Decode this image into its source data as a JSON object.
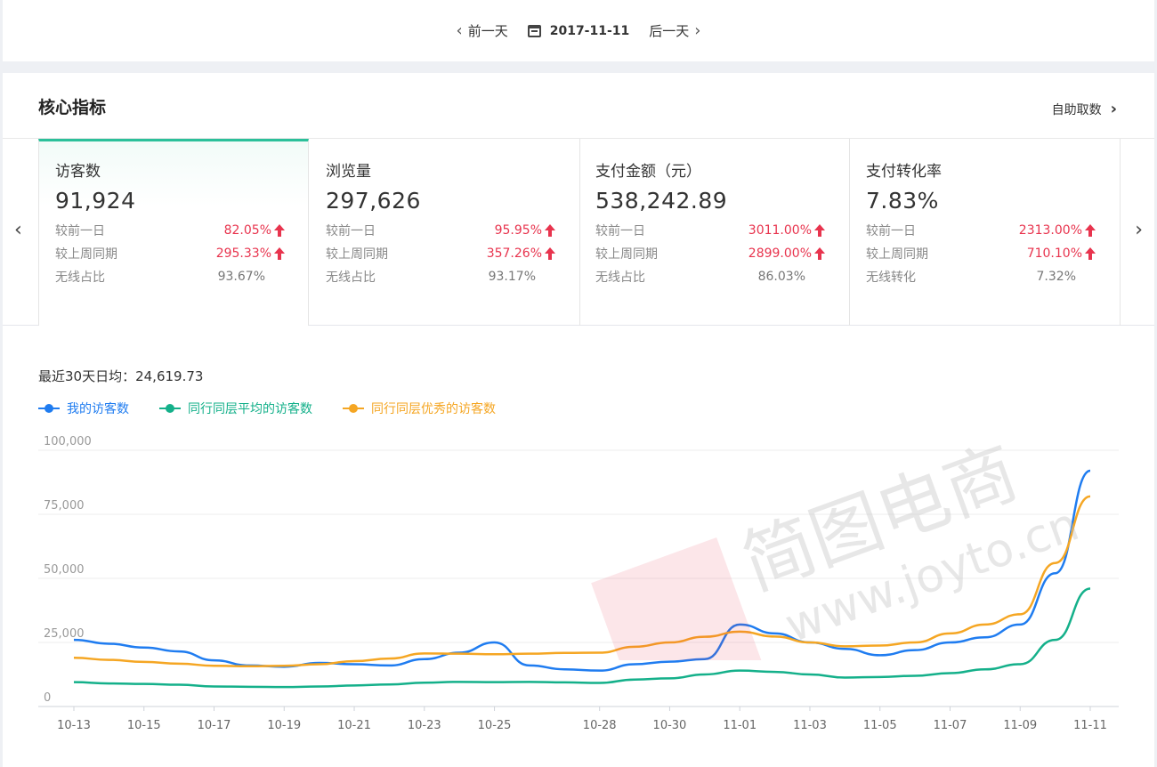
{
  "datebar": {
    "prev_label": "前一天",
    "date": "2017-11-11",
    "next_label": "后一天"
  },
  "card": {
    "title": "核心指标",
    "self_fetch": "自助取数"
  },
  "tiles": [
    {
      "name": "访客数",
      "value": "91,924",
      "r1_label": "较前一日",
      "r1_value": "82.05%",
      "r2_label": "较上周同期",
      "r2_value": "295.33%",
      "r3_label": "无线占比",
      "r3_value": "93.67%"
    },
    {
      "name": "浏览量",
      "value": "297,626",
      "r1_label": "较前一日",
      "r1_value": "95.95%",
      "r2_label": "较上周同期",
      "r2_value": "357.26%",
      "r3_label": "无线占比",
      "r3_value": "93.17%"
    },
    {
      "name": "支付金额（元）",
      "value": "538,242.89",
      "r1_label": "较前一日",
      "r1_value": "3011.00%",
      "r2_label": "较上周同期",
      "r2_value": "2899.00%",
      "r3_label": "无线占比",
      "r3_value": "86.03%"
    },
    {
      "name": "支付转化率",
      "value": "7.83%",
      "r1_label": "较前一日",
      "r1_value": "2313.00%",
      "r2_label": "较上周同期",
      "r2_value": "710.10%",
      "r3_label": "无线转化",
      "r3_value": "7.32%"
    }
  ],
  "avg_text": "最近30天日均：24,619.73",
  "watermark": {
    "cn": "简图电商",
    "url": "www.joyto.cn"
  },
  "colors": {
    "accent": "#2bc09a",
    "up": "#e8344e",
    "mine": "#1f7cf0",
    "avg": "#14b08a",
    "excellent": "#f5a623"
  },
  "chart_data": {
    "type": "line",
    "x": [
      "10-13",
      "10-14",
      "10-15",
      "10-16",
      "10-17",
      "10-18",
      "10-19",
      "10-20",
      "10-21",
      "10-22",
      "10-23",
      "10-24",
      "10-25",
      "10-26",
      "10-27",
      "10-28",
      "10-29",
      "10-30",
      "10-31",
      "11-01",
      "11-02",
      "11-03",
      "11-04",
      "11-05",
      "11-06",
      "11-07",
      "11-08",
      "11-09",
      "11-10",
      "11-11"
    ],
    "xticks": [
      "10-13",
      "10-15",
      "10-17",
      "10-19",
      "10-21",
      "10-23",
      "10-25",
      "10-28",
      "10-30",
      "11-01",
      "11-03",
      "11-05",
      "11-07",
      "11-09",
      "11-11"
    ],
    "yticks": [
      "0",
      "25,000",
      "50,000",
      "75,000",
      "100,000"
    ],
    "ylim": [
      0,
      100000
    ],
    "series": [
      {
        "name": "我的访客数",
        "color": "#1f7cf0",
        "values": [
          26000,
          24500,
          23000,
          21500,
          18000,
          16000,
          15500,
          17000,
          16500,
          16000,
          18500,
          21000,
          25000,
          16000,
          14500,
          14000,
          16500,
          17500,
          18500,
          32000,
          28500,
          25000,
          22500,
          20000,
          22000,
          25000,
          27000,
          32000,
          52000,
          92000
        ]
      },
      {
        "name": "同行同层平均的访客数",
        "color": "#14b08a",
        "values": [
          9500,
          9000,
          8800,
          8500,
          7800,
          7700,
          7600,
          7800,
          8200,
          8600,
          9300,
          9600,
          9500,
          9600,
          9400,
          9200,
          10500,
          11000,
          12500,
          14000,
          13500,
          12500,
          11300,
          11500,
          12000,
          13000,
          14500,
          16500,
          26000,
          46000
        ]
      },
      {
        "name": "同行同层优秀的访客数",
        "color": "#f5a623",
        "values": [
          19000,
          18200,
          17400,
          16700,
          15900,
          15700,
          15900,
          16500,
          17700,
          18700,
          20700,
          20600,
          20400,
          20600,
          20900,
          21000,
          23300,
          25000,
          27200,
          29200,
          27300,
          25000,
          23500,
          23800,
          25000,
          28500,
          32000,
          36000,
          56000,
          82000
        ]
      }
    ]
  }
}
